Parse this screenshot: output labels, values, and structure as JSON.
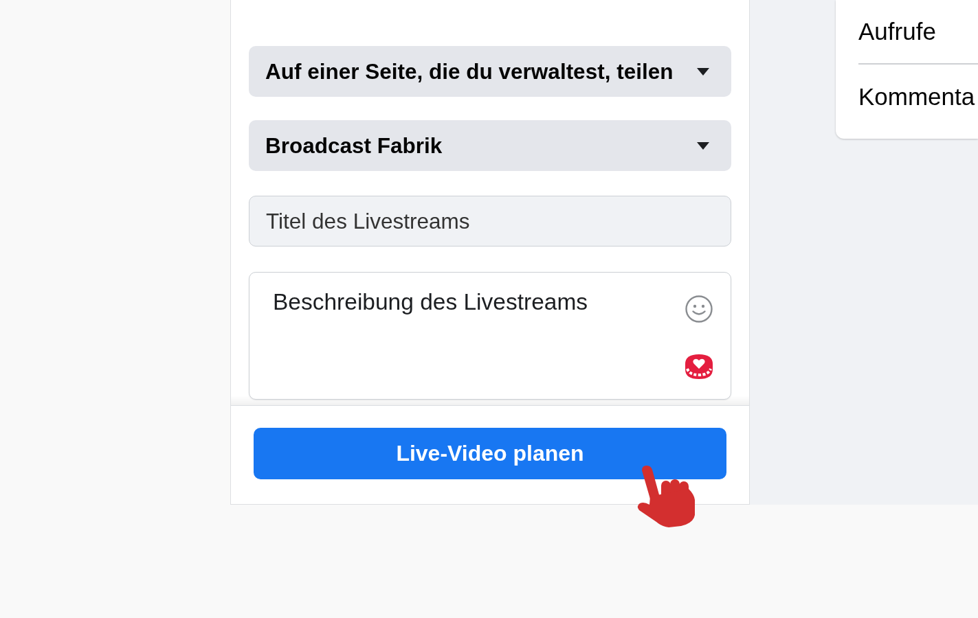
{
  "composer": {
    "selects": [
      {
        "value": "Auf einer Seite, die du verwaltest, teilen"
      },
      {
        "value": "Broadcast Fabrik"
      }
    ],
    "title_field": {
      "placeholder": "Titel des Livestreams"
    },
    "description_field": {
      "placeholder": "Beschreibung des Livestreams"
    },
    "submit_button": {
      "label": "Live-Video planen"
    }
  },
  "stats_card": {
    "items": [
      {
        "label": "Aufrufe"
      },
      {
        "label": "Kommenta"
      }
    ]
  }
}
